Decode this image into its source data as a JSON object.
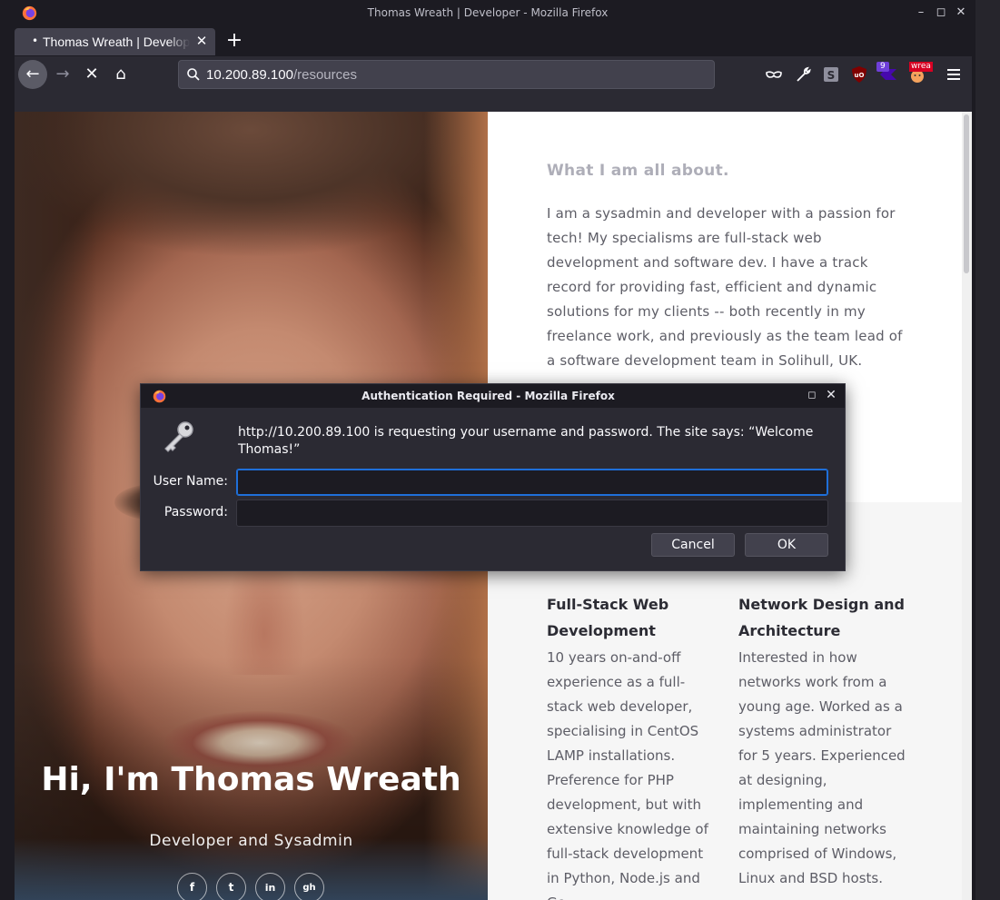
{
  "window": {
    "title": "Thomas Wreath | Developer - Mozilla Firefox",
    "controls": {
      "minimize": "–",
      "maximize": "◻",
      "close": "✕"
    }
  },
  "tabs": [
    {
      "title": "Thomas Wreath | Developer",
      "close": "✕",
      "indicator": "•"
    }
  ],
  "new_tab_label": "+",
  "toolbar": {
    "back": "←",
    "forward": "→",
    "stop": "✕",
    "home": "⌂",
    "url_host": "10.200.89.100",
    "url_path": "/resources",
    "extension_badge_count": "9",
    "extension_badge_text": "wrea"
  },
  "hero": {
    "title": "Hi, I'm Thomas Wreath",
    "subtitle": "Developer and Sysadmin",
    "social": [
      "f",
      "t",
      "in",
      "gh"
    ]
  },
  "about": {
    "heading": "What I am all about.",
    "body": "I am a sysadmin and developer with a passion for tech! My specialisms are full-stack web development and software dev. I have a track record for providing fast, efficient and dynamic solutions for my clients -- both recently in my freelance work, and previously as the team lead of a software development team in Solihull, UK."
  },
  "skills": [
    {
      "title": "Full-Stack Web Development",
      "text": "10 years on-and-off experience as a full-stack web developer, specialising in CentOS LAMP installations. Preference for PHP development, but with extensive knowledge of full-stack development in Python, Node.js and Go"
    },
    {
      "title": "Network Design and Architecture",
      "text": "Interested in how networks work from a young age. Worked as a systems administrator for 5 years. Experienced at designing, implementing and maintaining networks comprised of Windows, Linux and BSD hosts."
    }
  ],
  "dialog": {
    "title": "Authentication Required - Mozilla Firefox",
    "message": "http://10.200.89.100 is requesting your username and password. The site says: “Welcome Thomas!”",
    "username_label": "User Name:",
    "password_label": "Password:",
    "username_value": "",
    "password_value": "",
    "cancel_label": "Cancel",
    "ok_label": "OK"
  },
  "colors": {
    "chrome_dark": "#1c1b22",
    "toolbar": "#2b2a33",
    "focus_ring": "#1f6fd9",
    "heading_grey": "#aeaeb8"
  }
}
